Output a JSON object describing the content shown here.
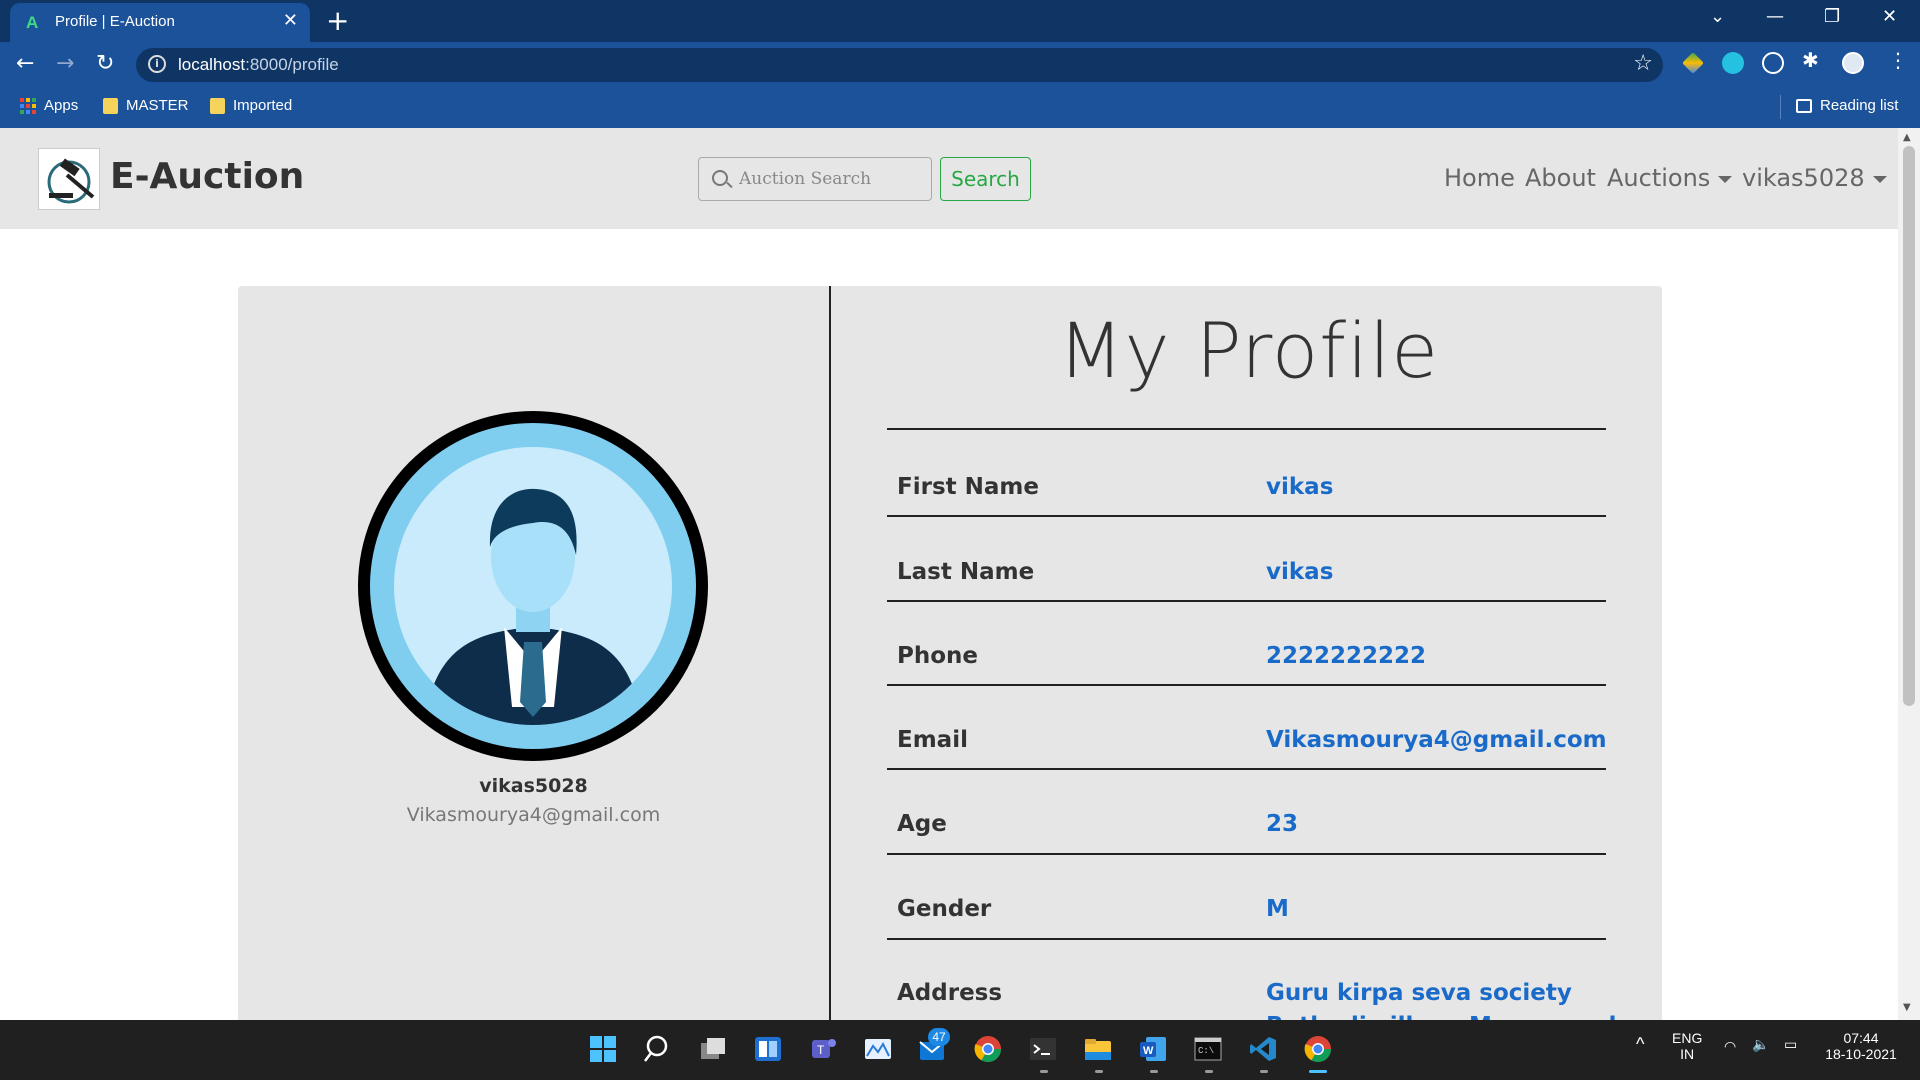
{
  "browser": {
    "tab_title": "Profile | E-Auction",
    "url_host": "localhost",
    "url_path": ":8000/profile",
    "bookmarks": [
      "Apps",
      "MASTER",
      "Imported"
    ],
    "reading_list": "Reading list"
  },
  "site": {
    "brand": "E-Auction",
    "search_placeholder": "Auction Search",
    "search_button": "Search",
    "nav": {
      "home": "Home",
      "about": "About",
      "auctions": "Auctions",
      "user": "vikas5028"
    }
  },
  "profile": {
    "title": "My Profile",
    "username": "vikas5028",
    "email": "Vikasmourya4@gmail.com",
    "fields": [
      {
        "label": "First Name",
        "value": "vikas"
      },
      {
        "label": "Last Name",
        "value": "vikas"
      },
      {
        "label": "Phone",
        "value": "2222222222"
      },
      {
        "label": "Email",
        "value": "Vikasmourya4@gmail.com"
      },
      {
        "label": "Age",
        "value": "23"
      },
      {
        "label": "Gender",
        "value": "M"
      },
      {
        "label": "Address",
        "value_line1": "Guru kirpa seva society",
        "value_line2": "Rathodi village Marve road"
      }
    ]
  },
  "taskbar": {
    "badge_count": "47",
    "lang": "ENG",
    "region": "IN",
    "time": "07:44",
    "date": "18-10-2021"
  },
  "colors": {
    "chrome_dark": "#0f3565",
    "chrome_tab": "#1b5299",
    "navbar_bg": "#e6e6e6",
    "value_blue": "#1a6bc9",
    "search_green": "#28a745"
  }
}
